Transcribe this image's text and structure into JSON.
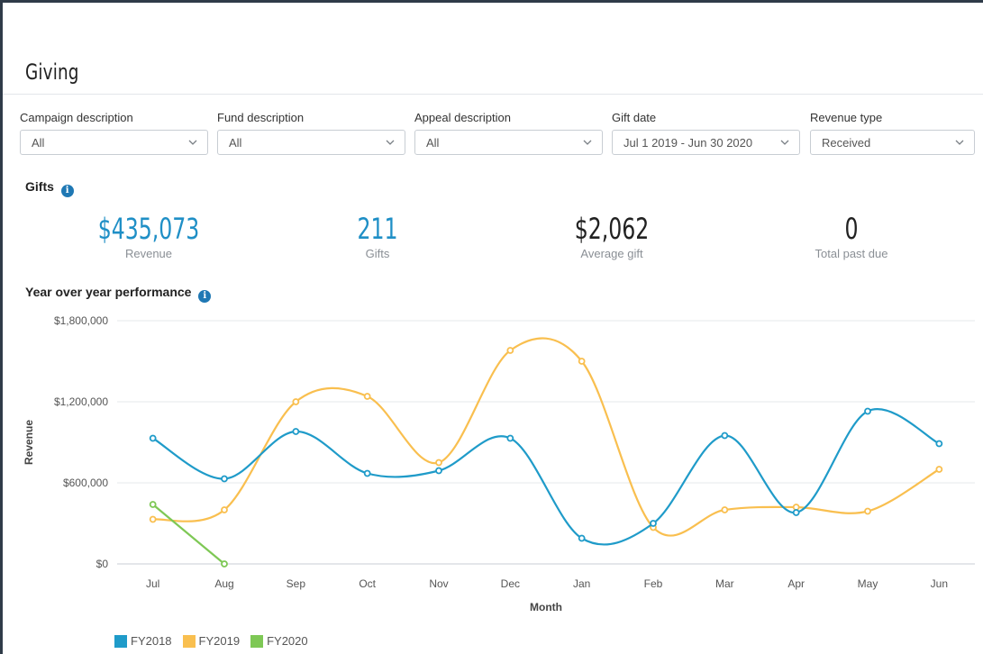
{
  "page": {
    "title": "Giving"
  },
  "filters": [
    {
      "label": "Campaign description",
      "value": "All"
    },
    {
      "label": "Fund description",
      "value": "All"
    },
    {
      "label": "Appeal description",
      "value": "All"
    },
    {
      "label": "Gift date",
      "value": "Jul 1 2019 - Jun 30 2020"
    },
    {
      "label": "Revenue type",
      "value": "Received"
    }
  ],
  "gifts": {
    "section_label": "Gifts",
    "metrics": [
      {
        "value": "$435,073",
        "label": "Revenue"
      },
      {
        "value": "211",
        "label": "Gifts"
      },
      {
        "value": "$2,062",
        "label": "Average gift"
      },
      {
        "value": "0",
        "label": "Total past due"
      }
    ]
  },
  "yoy": {
    "section_label": "Year over year performance"
  },
  "colors": {
    "accent": "#1f8fc6",
    "fy2018": "#1f9bc9",
    "fy2019": "#f9bf4f",
    "fy2020": "#7ec855"
  },
  "chart_data": {
    "type": "line",
    "xlabel": "Month",
    "ylabel": "Revenue",
    "categories": [
      "Jul",
      "Aug",
      "Sep",
      "Oct",
      "Nov",
      "Dec",
      "Jan",
      "Feb",
      "Mar",
      "Apr",
      "May",
      "Jun"
    ],
    "ylim": [
      0,
      1800000
    ],
    "yticks": [
      0,
      600000,
      1200000,
      1800000
    ],
    "ytick_labels": [
      "$0",
      "$600,000",
      "$1,200,000",
      "$1,800,000"
    ],
    "grid": true,
    "legend_position": "bottom-left",
    "series": [
      {
        "name": "FY2018",
        "color": "#1f9bc9",
        "values": [
          930000,
          630000,
          980000,
          670000,
          690000,
          930000,
          190000,
          300000,
          950000,
          380000,
          1130000,
          890000
        ]
      },
      {
        "name": "FY2019",
        "color": "#f9bf4f",
        "values": [
          330000,
          400000,
          1200000,
          1240000,
          750000,
          1580000,
          1500000,
          270000,
          400000,
          420000,
          390000,
          700000
        ]
      },
      {
        "name": "FY2020",
        "color": "#7ec855",
        "values": [
          440000,
          0
        ]
      }
    ]
  }
}
